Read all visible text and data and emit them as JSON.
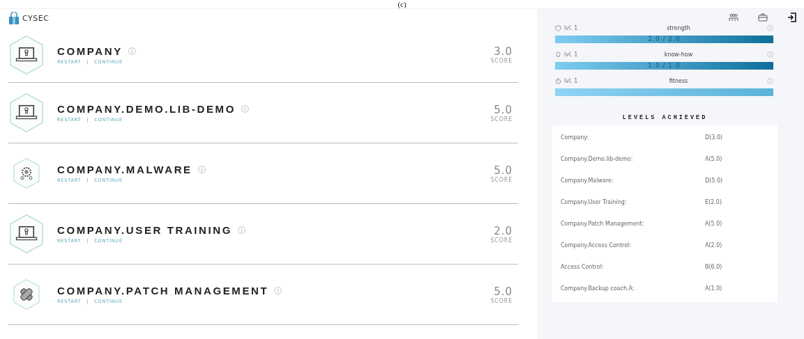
{
  "figure_label": "(c)",
  "brand": "CYSEC",
  "courses": [
    {
      "title": "COMPANY",
      "kind": "laptop",
      "restart": "RESTART",
      "separator": "|",
      "continue": "CONTINUE",
      "score": "3.0",
      "score_label": "SCORE"
    },
    {
      "title": "COMPANY.DEMO.LIB-DEMO",
      "kind": "laptop",
      "restart": "RESTART",
      "separator": "|",
      "continue": "CONTINUE",
      "score": "5.0",
      "score_label": "SCORE"
    },
    {
      "title": "COMPANY.MALWARE",
      "kind": "gear",
      "restart": "RESTART",
      "separator": "|",
      "continue": "CONTINUE",
      "score": "5.0",
      "score_label": "SCORE"
    },
    {
      "title": "COMPANY.USER TRAINING",
      "kind": "laptop",
      "restart": "RESTART",
      "separator": "|",
      "continue": "CONTINUE",
      "score": "2.0",
      "score_label": "SCORE"
    },
    {
      "title": "COMPANY.PATCH MANAGEMENT",
      "kind": "bandage",
      "restart": "RESTART",
      "separator": "|",
      "continue": "CONTINUE",
      "score": "5.0",
      "score_label": "SCORE"
    }
  ],
  "stats": [
    {
      "kind": "shield",
      "level_label": "lvl. 1",
      "name": "strength",
      "level": 1,
      "reading": "2.0 / 2.0"
    },
    {
      "kind": "bulb",
      "level_label": "lvl. 1",
      "name": "know-how",
      "level": 1,
      "reading": "1.0 / 1.0"
    },
    {
      "kind": "stopwatch",
      "level_label": "lvl. 1",
      "name": "fitness",
      "level": 1
    }
  ],
  "levels_achieved": {
    "title": "LEVELS ACHIEVED",
    "rows": [
      {
        "name": "Company:",
        "grade": "D(3.0)"
      },
      {
        "name": "Company.Demo.lib-demo:",
        "grade": "A(5.0)"
      },
      {
        "name": "Company.Malware:",
        "grade": "D(5.0)"
      },
      {
        "name": "Company.User Training:",
        "grade": "E(2.0)"
      },
      {
        "name": "Company.Patch Management:",
        "grade": "A(5.0)"
      },
      {
        "name": "Company.Access Control:",
        "grade": "A(2.0)"
      },
      {
        "name": "Access Control:",
        "grade": "B(6.0)"
      },
      {
        "name": "Company.Backup coach.A:",
        "grade": "A(1.0)"
      }
    ]
  }
}
